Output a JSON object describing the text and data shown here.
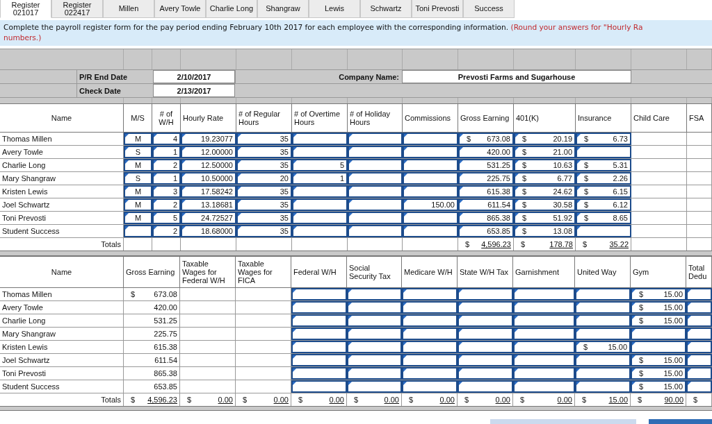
{
  "tabs": [
    {
      "label": "Register 021017",
      "selected": true
    },
    {
      "label": "Register 022417",
      "selected": false
    },
    {
      "label": "Millen",
      "selected": false
    },
    {
      "label": "Avery Towle",
      "selected": false
    },
    {
      "label": "Charlie Long",
      "selected": false
    },
    {
      "label": "Shangraw",
      "selected": false
    },
    {
      "label": "Lewis",
      "selected": false
    },
    {
      "label": "Schwartz",
      "selected": false
    },
    {
      "label": "Toni Prevosti",
      "selected": false
    },
    {
      "label": "Success",
      "selected": false
    }
  ],
  "instruction": {
    "text": "Complete the payroll register form for the pay period ending February 10th 2017 for each employee with the corresponding information. ",
    "note": [
      "(Round your answers for \"Hourly Ra",
      "numbers.)"
    ]
  },
  "header": {
    "pr_end_date": {
      "label": "P/R End Date",
      "value": "2/10/2017"
    },
    "check_date": {
      "label": "Check Date",
      "value": "2/13/2017"
    },
    "company": {
      "label": "Company Name:",
      "value": "Prevosti Farms and Sugarhouse"
    }
  },
  "tables": [
    {
      "columns": [
        {
          "label": "Name",
          "input": false
        },
        {
          "label": "M/S",
          "input": true
        },
        {
          "label": "# of W/H",
          "input": true
        },
        {
          "label": "Hourly Rate",
          "input": true
        },
        {
          "label": "# of Regular Hours",
          "input": true
        },
        {
          "label": "# of Overtime Hours",
          "input": true
        },
        {
          "label": "# of Holiday Hours",
          "input": true
        },
        {
          "label": "Commissions",
          "input": true
        },
        {
          "label": "Gross Earning",
          "input": true
        },
        {
          "label": "401(K)",
          "input": true
        },
        {
          "label": "Insurance",
          "input": true
        },
        {
          "label": "Child Care",
          "input": false
        },
        {
          "label": "FSA",
          "input": false
        }
      ],
      "rows": [
        {
          "cells": [
            "Thomas Millen",
            "M",
            "4",
            "19.23077",
            "35",
            null,
            null,
            null,
            {
              "sign": "$",
              "text": "673.08"
            },
            {
              "sign": "$",
              "text": "20.19"
            },
            {
              "sign": "$",
              "text": "6.73"
            },
            null,
            null
          ]
        },
        {
          "cells": [
            "Avery Towle",
            "S",
            "1",
            "12.00000",
            "35",
            null,
            null,
            null,
            "420.00",
            {
              "sign": "$",
              "text": "21.00"
            },
            null,
            null,
            null
          ]
        },
        {
          "cells": [
            "Charlie Long",
            "M",
            "2",
            "12.50000",
            "35",
            "5",
            null,
            null,
            "531.25",
            {
              "sign": "$",
              "text": "10.63"
            },
            {
              "sign": "$",
              "text": "5.31"
            },
            null,
            null
          ]
        },
        {
          "cells": [
            "Mary Shangraw",
            "S",
            "1",
            "10.50000",
            "20",
            "1",
            null,
            null,
            "225.75",
            {
              "sign": "$",
              "text": "6.77"
            },
            {
              "sign": "$",
              "text": "2.26"
            },
            null,
            null
          ]
        },
        {
          "cells": [
            "Kristen Lewis",
            "M",
            "3",
            "17.58242",
            "35",
            null,
            null,
            null,
            "615.38",
            {
              "sign": "$",
              "text": "24.62"
            },
            {
              "sign": "$",
              "text": "6.15"
            },
            null,
            null
          ]
        },
        {
          "cells": [
            "Joel Schwartz",
            "M",
            "2",
            "13.18681",
            "35",
            null,
            null,
            "150.00",
            "611.54",
            {
              "sign": "$",
              "text": "30.58"
            },
            {
              "sign": "$",
              "text": "6.12"
            },
            null,
            null
          ]
        },
        {
          "cells": [
            "Toni Prevosti",
            "M",
            "5",
            "24.72527",
            "35",
            null,
            null,
            null,
            "865.38",
            {
              "sign": "$",
              "text": "51.92"
            },
            {
              "sign": "$",
              "text": "8.65"
            },
            null,
            null
          ]
        },
        {
          "cells": [
            "Student Success",
            null,
            "2",
            "18.68000",
            "35",
            null,
            null,
            null,
            "653.85",
            {
              "sign": "$",
              "text": "13.08"
            },
            null,
            null,
            null
          ]
        }
      ],
      "totals_row": {
        "cells": [
          "Totals",
          null,
          null,
          null,
          null,
          null,
          null,
          null,
          {
            "sign": "$",
            "text": "4,596.23"
          },
          {
            "sign": "$",
            "text": "178.78"
          },
          {
            "sign": "$",
            "text": "35.22"
          },
          null,
          null
        ]
      }
    },
    {
      "columns": [
        {
          "label": "Name",
          "input": false
        },
        {
          "label": "Gross Earning",
          "input": false
        },
        {
          "label": "Taxable Wages for Federal W/H",
          "input": false
        },
        {
          "label": "Taxable Wages for FICA",
          "input": false
        },
        {
          "label": "Federal W/H",
          "input": true
        },
        {
          "label": "Social Security Tax",
          "input": true
        },
        {
          "label": "Medicare W/H",
          "input": true
        },
        {
          "label": "State W/H Tax",
          "input": true
        },
        {
          "label": "Garnishment",
          "input": true
        },
        {
          "label": "United Way",
          "input": true
        },
        {
          "label": "Gym",
          "input": true
        },
        {
          "label": "Total Dedu",
          "input": true
        }
      ],
      "rows": [
        {
          "cells": [
            "Thomas Millen",
            {
              "sign": "$",
              "text": "673.08"
            },
            null,
            null,
            null,
            null,
            null,
            null,
            null,
            null,
            {
              "sign": "$",
              "text": "15.00"
            },
            null
          ]
        },
        {
          "cells": [
            "Avery Towle",
            "420.00",
            null,
            null,
            null,
            null,
            null,
            null,
            null,
            null,
            {
              "sign": "$",
              "text": "15.00"
            },
            null
          ]
        },
        {
          "cells": [
            "Charlie Long",
            "531.25",
            null,
            null,
            null,
            null,
            null,
            null,
            null,
            null,
            {
              "sign": "$",
              "text": "15.00"
            },
            null
          ]
        },
        {
          "cells": [
            "Mary Shangraw",
            "225.75",
            null,
            null,
            null,
            null,
            null,
            null,
            null,
            null,
            null,
            null
          ]
        },
        {
          "cells": [
            "Kristen Lewis",
            "615.38",
            null,
            null,
            null,
            null,
            null,
            null,
            null,
            {
              "sign": "$",
              "text": "15.00"
            },
            null,
            null
          ]
        },
        {
          "cells": [
            "Joel Schwartz",
            "611.54",
            null,
            null,
            null,
            null,
            null,
            null,
            null,
            null,
            {
              "sign": "$",
              "text": "15.00"
            },
            null
          ]
        },
        {
          "cells": [
            "Toni Prevosti",
            "865.38",
            null,
            null,
            null,
            null,
            null,
            null,
            null,
            null,
            {
              "sign": "$",
              "text": "15.00"
            },
            null
          ]
        },
        {
          "cells": [
            "Student Success",
            "653.85",
            null,
            null,
            null,
            null,
            null,
            null,
            null,
            null,
            {
              "sign": "$",
              "text": "15.00"
            },
            null
          ]
        }
      ],
      "totals_row": {
        "cells": [
          "Totals",
          {
            "sign": "$",
            "text": "4,596.23"
          },
          {
            "sign": "$",
            "text": "0.00"
          },
          {
            "sign": "$",
            "text": "0.00"
          },
          {
            "sign": "$",
            "text": "0.00"
          },
          {
            "sign": "$",
            "text": "0.00"
          },
          {
            "sign": "$",
            "text": "0.00"
          },
          {
            "sign": "$",
            "text": "0.00"
          },
          {
            "sign": "$",
            "text": "0.00"
          },
          {
            "sign": "$",
            "text": "15.00"
          },
          {
            "sign": "$",
            "text": "90.00"
          },
          {
            "sign": "$"
          }
        ]
      }
    }
  ],
  "buttons": [
    {
      "disabled": true
    },
    {
      "disabled": false
    }
  ]
}
